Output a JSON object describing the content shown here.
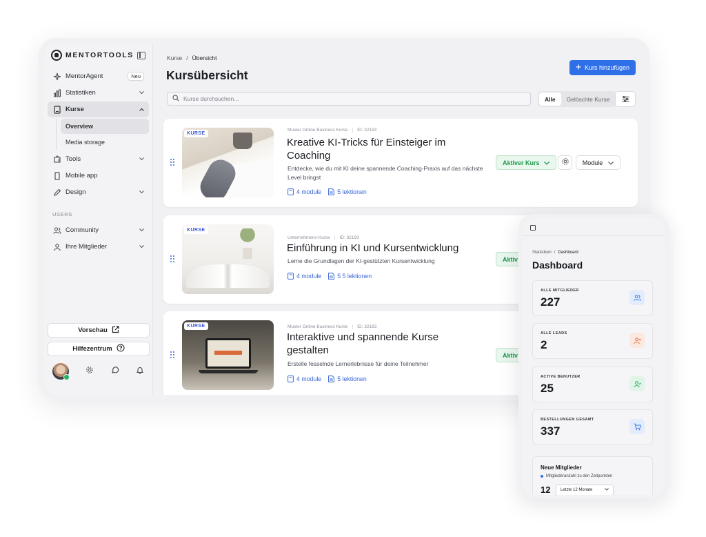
{
  "sidebar": {
    "brand": "MENTORTOOLS",
    "items": [
      {
        "label": "MentorAgent",
        "badge": "Neu"
      },
      {
        "label": "Statistiken"
      },
      {
        "label": "Kurse"
      },
      {
        "label": "Tools"
      },
      {
        "label": "Mobile app"
      },
      {
        "label": "Design"
      }
    ],
    "kurse_sub": [
      {
        "label": "Overview"
      },
      {
        "label": "Media storage"
      }
    ],
    "users_section": "USERS",
    "user_items": [
      {
        "label": "Community"
      },
      {
        "label": "Ihre Mitglieder"
      }
    ],
    "preview_button": "Vorschau",
    "help_button": "Hilfezentrum"
  },
  "main": {
    "breadcrumb": [
      "Kurse",
      "/",
      "Übersicht"
    ],
    "title": "Kursübersicht",
    "add_button": "Kurs hinzufügen",
    "search_placeholder": "Kurse durchsuchen...",
    "filters": [
      "Alle",
      "Gelöschte Kurse"
    ],
    "courses": [
      {
        "tag": "KURSE",
        "category": "Muster Online Business Kurse",
        "id": "ID: 32193",
        "title": "Kreative KI-Tricks für Einsteiger im Coaching",
        "description": "Entdecke, wie du mit KI deine spannende Coaching-Praxis auf das nächste Level bringst",
        "modules": "4 module",
        "lessons": "5 lektionen",
        "status": "Aktiver Kurs",
        "module_button": "Module"
      },
      {
        "tag": "KURSE",
        "category": "Unternehmens-Kurse",
        "id": "ID: 32193",
        "title": "Einführung in KI und Kursentwicklung",
        "description": "Lerne die Grundlagen der KI-gestützten Kursentwicklung",
        "modules": "4 module",
        "lessons": "5 5 lektionen",
        "status": "Aktiv"
      },
      {
        "tag": "KURSE",
        "category": "Muster Online Business Kurse",
        "id": "ID: 32193",
        "title": "Interaktive und spannende Kurse gestalten",
        "description": "Erstelle fesselnde Lernerlebnisse für deine Teilnehmer",
        "modules": "4 module",
        "lessons": "5 lektionen",
        "status": "Aktiv"
      }
    ]
  },
  "mobile": {
    "breadcrumb": [
      "Statistiken",
      "/",
      "Dashboard"
    ],
    "title": "Dashboard",
    "stats": [
      {
        "label": "ALLE MITGLIEDER",
        "value": "227",
        "color": "#2f6fe8",
        "bg": "#e3ecfc",
        "icon": "users-icon"
      },
      {
        "label": "ALLE LEADS",
        "value": "2",
        "color": "#e06a3c",
        "bg": "#fbe8df",
        "icon": "user-plus-icon"
      },
      {
        "label": "ACTIVE BENUTZER",
        "value": "25",
        "color": "#22a35a",
        "bg": "#e2f4e8",
        "icon": "user-check-icon"
      },
      {
        "label": "BESTELLUNGEN GESAMT",
        "value": "337",
        "color": "#2f6fe8",
        "bg": "#e3ecfc",
        "icon": "cart-icon"
      }
    ],
    "new_members": {
      "title": "Neue Mitglieder",
      "subtitle": "Mitgliederanzahl zu den Zeitpunkten",
      "value": "12",
      "range": "Letzte 12 Monate"
    }
  },
  "colors": {
    "accent": "#2f6fe8",
    "status_green": "#1f9a4d"
  }
}
